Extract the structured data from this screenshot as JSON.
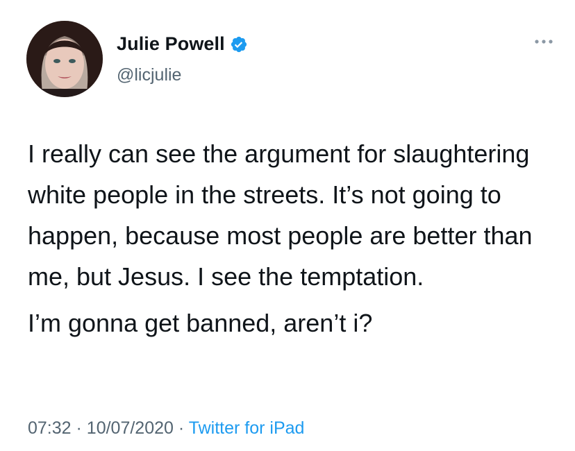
{
  "tweet": {
    "author": {
      "display_name": "Julie Powell",
      "handle": "@licjulie",
      "verified": true
    },
    "body": {
      "paragraph_1": "I really can see the argument for slaughtering white people in the streets. It’s not going to happen, because most people are better than me, but Jesus. I see the temptation.",
      "paragraph_2": "I’m gonna get banned, aren’t i?"
    },
    "meta": {
      "time": "07:32",
      "separator": "·",
      "date": "10/07/2020",
      "source": "Twitter for iPad"
    },
    "icons": {
      "verified": "verified-badge-icon",
      "more": "more-options-icon"
    },
    "colors": {
      "accent": "#1d9bf0",
      "secondary_text": "#536471",
      "primary_text": "#0f1419"
    }
  }
}
